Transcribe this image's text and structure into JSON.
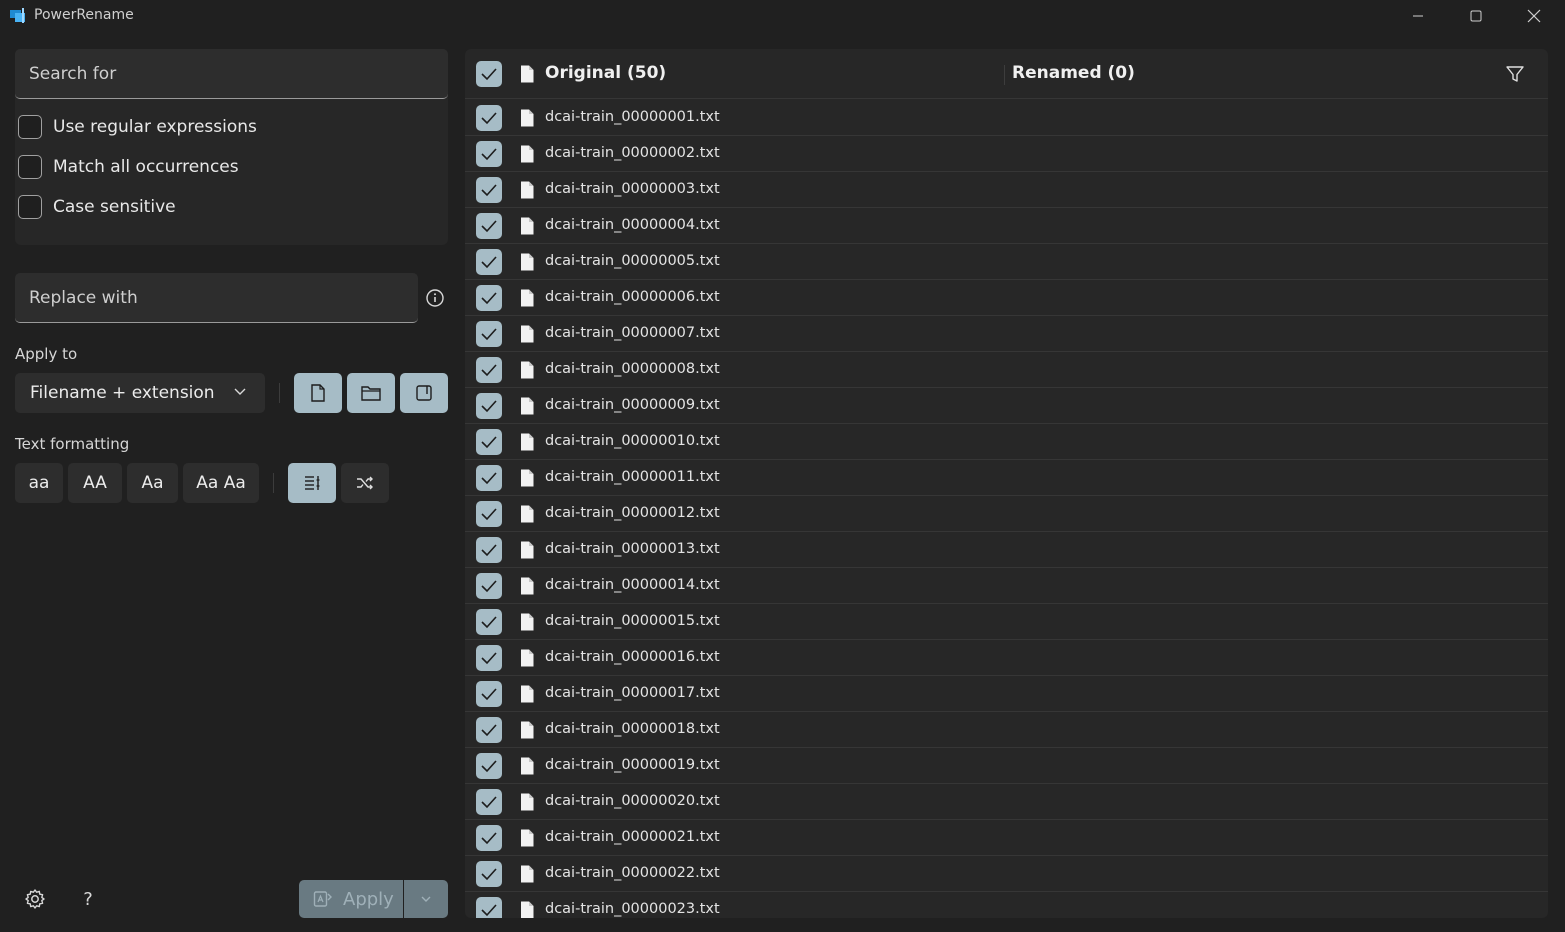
{
  "window": {
    "title": "PowerRename"
  },
  "search": {
    "placeholder": "Search for",
    "options": [
      {
        "label": "Use regular expressions",
        "checked": false
      },
      {
        "label": "Match all occurrences",
        "checked": false
      },
      {
        "label": "Case sensitive",
        "checked": false
      }
    ]
  },
  "replace": {
    "placeholder": "Replace with"
  },
  "apply_to": {
    "label": "Apply to",
    "selected": "Filename + extension",
    "toggles": [
      {
        "icon": "file-icon",
        "active": true
      },
      {
        "icon": "folder-icon",
        "active": true
      },
      {
        "icon": "subfolder-icon",
        "active": true
      }
    ]
  },
  "text_formatting": {
    "label": "Text formatting",
    "buttons": [
      {
        "label": "aa",
        "active": false
      },
      {
        "label": "AA",
        "active": false
      },
      {
        "label": "Aa",
        "active": false
      },
      {
        "label": "Aa Aa",
        "active": false
      }
    ],
    "enumerate_active": true,
    "randomize_active": false
  },
  "bottom": {
    "apply_label": "Apply",
    "help_glyph": "?"
  },
  "list": {
    "original_header": "Original (50)",
    "renamed_header": "Renamed (0)",
    "files": [
      "dcai-train_00000001.txt",
      "dcai-train_00000002.txt",
      "dcai-train_00000003.txt",
      "dcai-train_00000004.txt",
      "dcai-train_00000005.txt",
      "dcai-train_00000006.txt",
      "dcai-train_00000007.txt",
      "dcai-train_00000008.txt",
      "dcai-train_00000009.txt",
      "dcai-train_00000010.txt",
      "dcai-train_00000011.txt",
      "dcai-train_00000012.txt",
      "dcai-train_00000013.txt",
      "dcai-train_00000014.txt",
      "dcai-train_00000015.txt",
      "dcai-train_00000016.txt",
      "dcai-train_00000017.txt",
      "dcai-train_00000018.txt",
      "dcai-train_00000019.txt",
      "dcai-train_00000020.txt",
      "dcai-train_00000021.txt",
      "dcai-train_00000022.txt",
      "dcai-train_00000023.txt"
    ]
  },
  "colors": {
    "background": "#202020",
    "panel": "#272727",
    "accent": "#a6bcc6",
    "apply_disabled": "#697a82"
  }
}
